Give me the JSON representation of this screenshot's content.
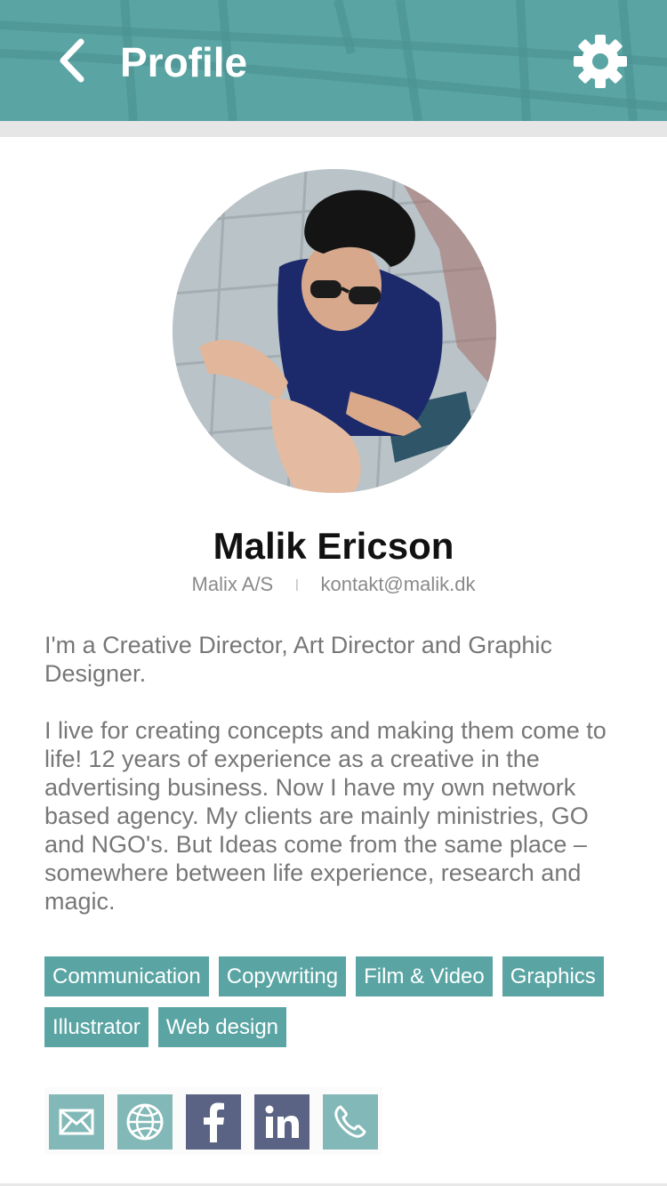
{
  "header": {
    "title": "Profile",
    "back_icon": "chevron-left-icon",
    "settings_icon": "gear-icon",
    "background_color": "#5aa5a4"
  },
  "profile": {
    "avatar_alt": "profile-photo",
    "name": "Malik Ericson",
    "company": "Malix A/S",
    "separator": "I",
    "email": "kontakt@malik.dk"
  },
  "bio": {
    "paragraphs": [
      "I'm a Creative Director, Art Director and Graphic Designer.",
      "I live for creating concepts and making them come to life! 12 years of experience as a creative in the advertising business. Now I have my own network based agency. My clients are mainly ministries, GO and NGO's. But Ideas come from the same place – somewhere between life experience, research and magic."
    ]
  },
  "tags": [
    "Communication",
    "Copywriting",
    "Film & Video",
    "Graphics",
    "Illustrator",
    "Web design"
  ],
  "social": [
    {
      "name": "email-icon",
      "color": "#82b8b7"
    },
    {
      "name": "globe-icon",
      "color": "#82b8b7"
    },
    {
      "name": "facebook-icon",
      "color": "#5a6384"
    },
    {
      "name": "linkedin-icon",
      "color": "#5a6384"
    },
    {
      "name": "phone-icon",
      "color": "#82b8b7"
    }
  ],
  "colors": {
    "accent": "#5aa5a4",
    "text_muted": "#777777",
    "social_dark": "#5a6384",
    "social_light": "#82b8b7"
  }
}
